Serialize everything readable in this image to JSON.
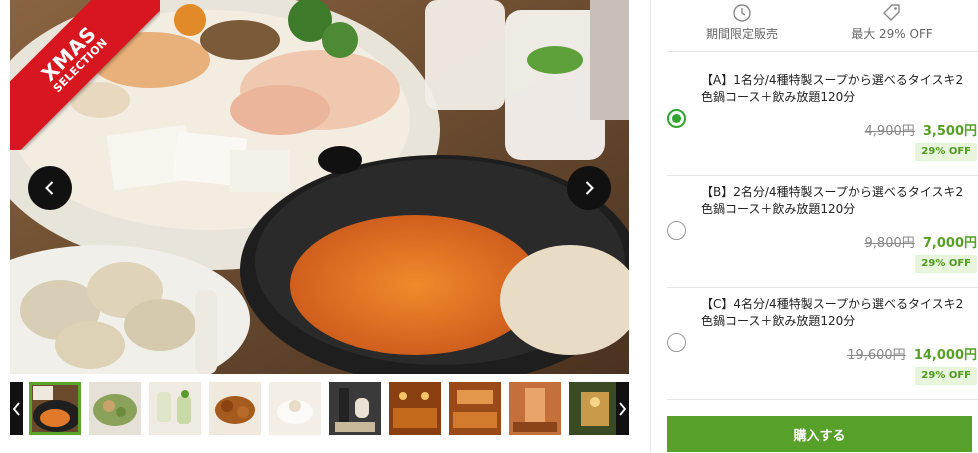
{
  "gallery": {
    "ribbon_line1": "XMAS",
    "ribbon_line2": "SELECTION",
    "thumbnails": [
      "hotpot",
      "salad",
      "drinks",
      "fried-chicken",
      "dessert",
      "wine",
      "interior-1",
      "interior-2",
      "interior-3",
      "interior-4"
    ],
    "selected_index": 0
  },
  "info": {
    "limited": "期間限定販売",
    "discount": "最大 29% OFF"
  },
  "courses": [
    {
      "title": "【A】1名分/4種特製スープから選べるタイスキ2色鍋コース＋飲み放題120分",
      "old_price": "4,900円",
      "new_price": "3,500円",
      "off": "29% OFF",
      "selected": true
    },
    {
      "title": "【B】2名分/4種特製スープから選べるタイスキ2色鍋コース＋飲み放題120分",
      "old_price": "9,800円",
      "new_price": "7,000円",
      "off": "29% OFF",
      "selected": false
    },
    {
      "title": "【C】4名分/4種特製スープから選べるタイスキ2色鍋コース＋飲み放題120分",
      "old_price": "19,600円",
      "new_price": "14,000円",
      "off": "29% OFF",
      "selected": false
    }
  ],
  "buy_label": "購入する",
  "colors": {
    "accent": "#57a12a",
    "ribbon": "#d7161f"
  }
}
